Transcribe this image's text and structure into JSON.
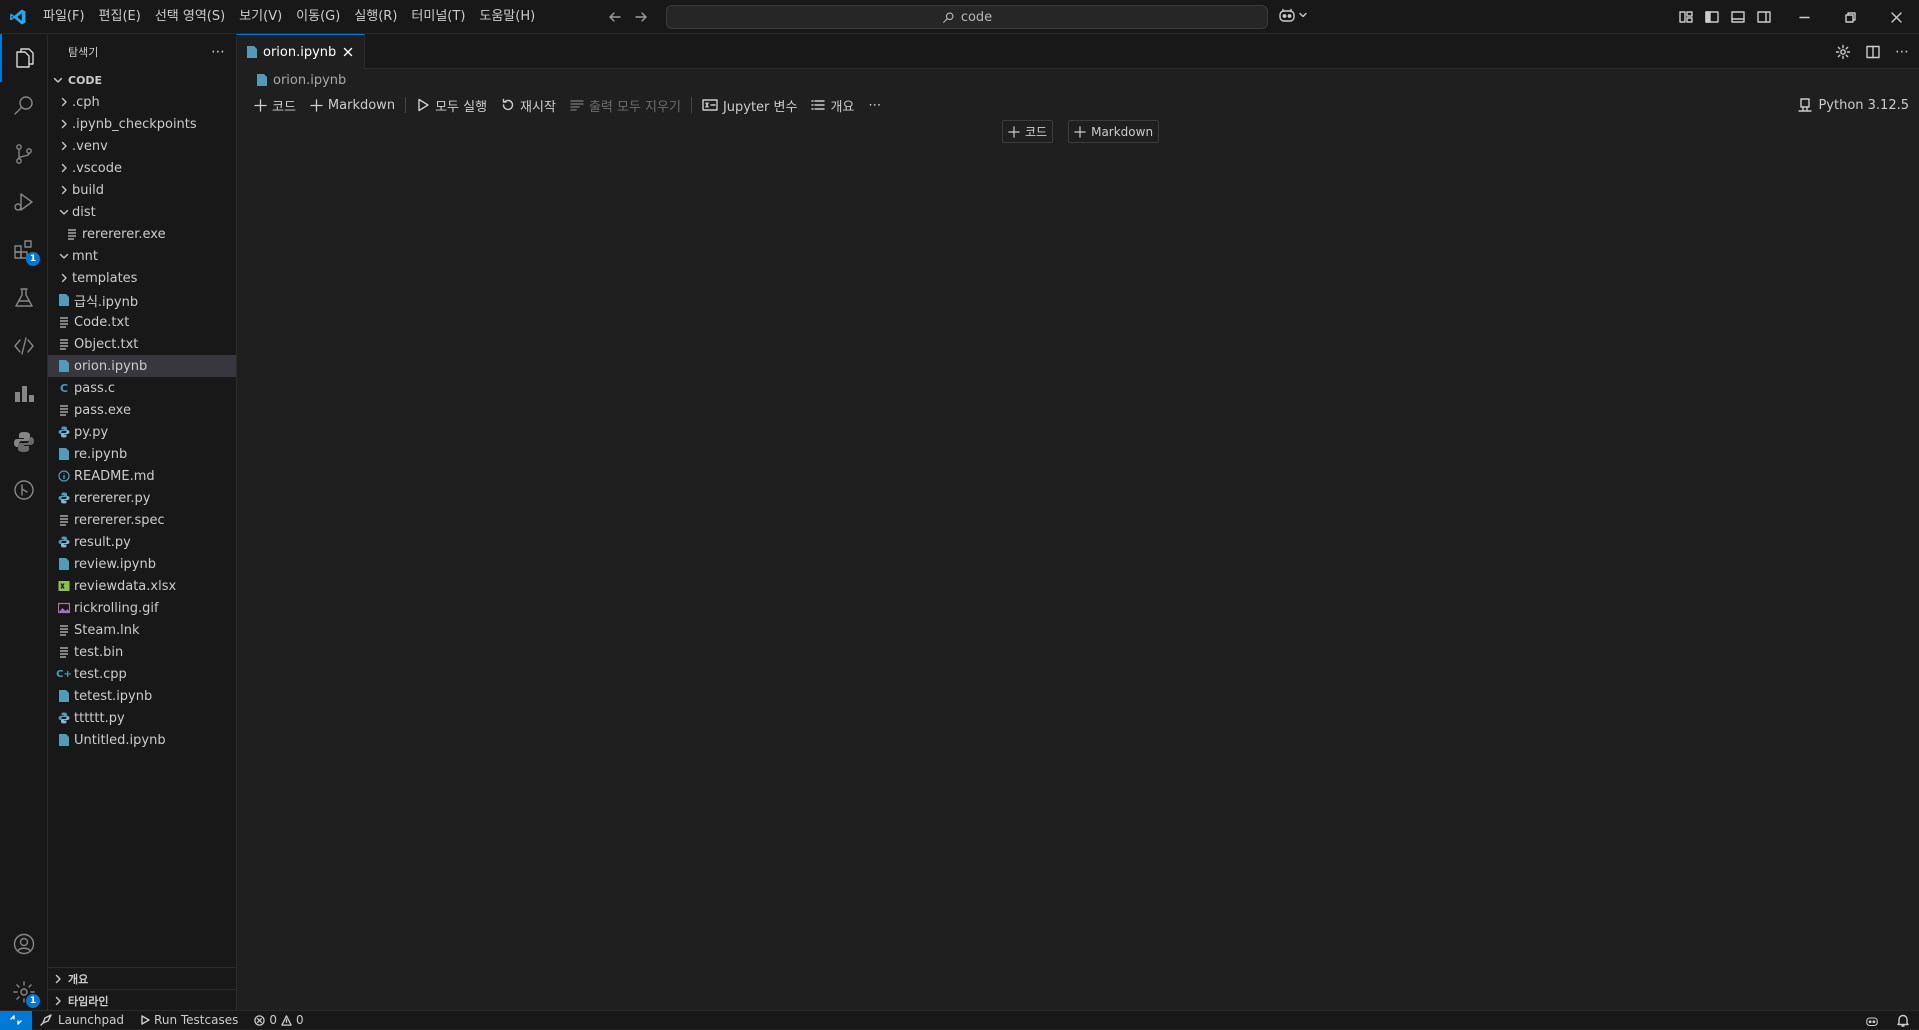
{
  "titlebar": {
    "menu": [
      "파일(F)",
      "편집(E)",
      "선택 영역(S)",
      "보기(V)",
      "이동(G)",
      "실행(R)",
      "터미널(T)",
      "도움말(H)"
    ],
    "search_text": "code"
  },
  "activity": {
    "extensions_badge": "1",
    "settings_badge": "1"
  },
  "sidebar": {
    "title": "탐색기",
    "root": "CODE",
    "items": [
      {
        "label": ".cph",
        "kind": "folder",
        "depth": 1,
        "open": false
      },
      {
        "label": ".ipynb_checkpoints",
        "kind": "folder",
        "depth": 1,
        "open": false
      },
      {
        "label": ".venv",
        "kind": "folder",
        "depth": 1,
        "open": false
      },
      {
        "label": ".vscode",
        "kind": "folder",
        "depth": 1,
        "open": false
      },
      {
        "label": "build",
        "kind": "folder",
        "depth": 1,
        "open": false
      },
      {
        "label": "dist",
        "kind": "folder",
        "depth": 1,
        "open": true
      },
      {
        "label": "rerererer.exe",
        "kind": "lines",
        "depth": 2
      },
      {
        "label": "mnt",
        "kind": "folder",
        "depth": 1,
        "open": true
      },
      {
        "label": "templates",
        "kind": "folder",
        "depth": 1,
        "open": false
      },
      {
        "label": "급식.ipynb",
        "kind": "notebook",
        "depth": 1
      },
      {
        "label": "Code.txt",
        "kind": "lines",
        "depth": 1
      },
      {
        "label": "Object.txt",
        "kind": "lines",
        "depth": 1
      },
      {
        "label": "orion.ipynb",
        "kind": "notebook",
        "depth": 1,
        "selected": true
      },
      {
        "label": "pass.c",
        "kind": "c",
        "depth": 1
      },
      {
        "label": "pass.exe",
        "kind": "lines",
        "depth": 1
      },
      {
        "label": "py.py",
        "kind": "python",
        "depth": 1
      },
      {
        "label": "re.ipynb",
        "kind": "notebook",
        "depth": 1
      },
      {
        "label": "README.md",
        "kind": "info",
        "depth": 1
      },
      {
        "label": "rerererer.py",
        "kind": "python",
        "depth": 1
      },
      {
        "label": "rerererer.spec",
        "kind": "lines",
        "depth": 1
      },
      {
        "label": "result.py",
        "kind": "python",
        "depth": 1
      },
      {
        "label": "review.ipynb",
        "kind": "notebook",
        "depth": 1
      },
      {
        "label": "reviewdata.xlsx",
        "kind": "excel",
        "depth": 1
      },
      {
        "label": "rickrolling.gif",
        "kind": "image",
        "depth": 1
      },
      {
        "label": "Steam.lnk",
        "kind": "lines",
        "depth": 1
      },
      {
        "label": "test.bin",
        "kind": "lines",
        "depth": 1
      },
      {
        "label": "test.cpp",
        "kind": "cpp",
        "depth": 1
      },
      {
        "label": "tetest.ipynb",
        "kind": "notebook",
        "depth": 1
      },
      {
        "label": "tttttt.py",
        "kind": "python",
        "depth": 1
      },
      {
        "label": "Untitled.ipynb",
        "kind": "notebook",
        "depth": 1
      }
    ],
    "outline": "개요",
    "timeline": "타임라인"
  },
  "editor": {
    "tab_label": "orion.ipynb",
    "breadcrumb": "orion.ipynb",
    "toolbar": {
      "code": "코드",
      "markdown": "Markdown",
      "run_all": "모두 실행",
      "restart": "재시작",
      "clear_outputs": "출력 모두 지우기",
      "variables": "Jupyter 변수",
      "outline": "개요",
      "more": "⋯"
    },
    "kernel": "Python 3.12.5",
    "cell_add_code": "코드",
    "cell_add_markdown": "Markdown"
  },
  "statusbar": {
    "launchpad": "Launchpad",
    "run_testcases": "Run Testcases",
    "errors": "0",
    "warnings": "0"
  },
  "colors": {
    "accent": "#0078d4",
    "notebook_icon": "#519aba",
    "python_icon": "#519aba",
    "excel_icon": "#8dc149",
    "image_icon": "#a074c4",
    "info_icon": "#519aba"
  }
}
